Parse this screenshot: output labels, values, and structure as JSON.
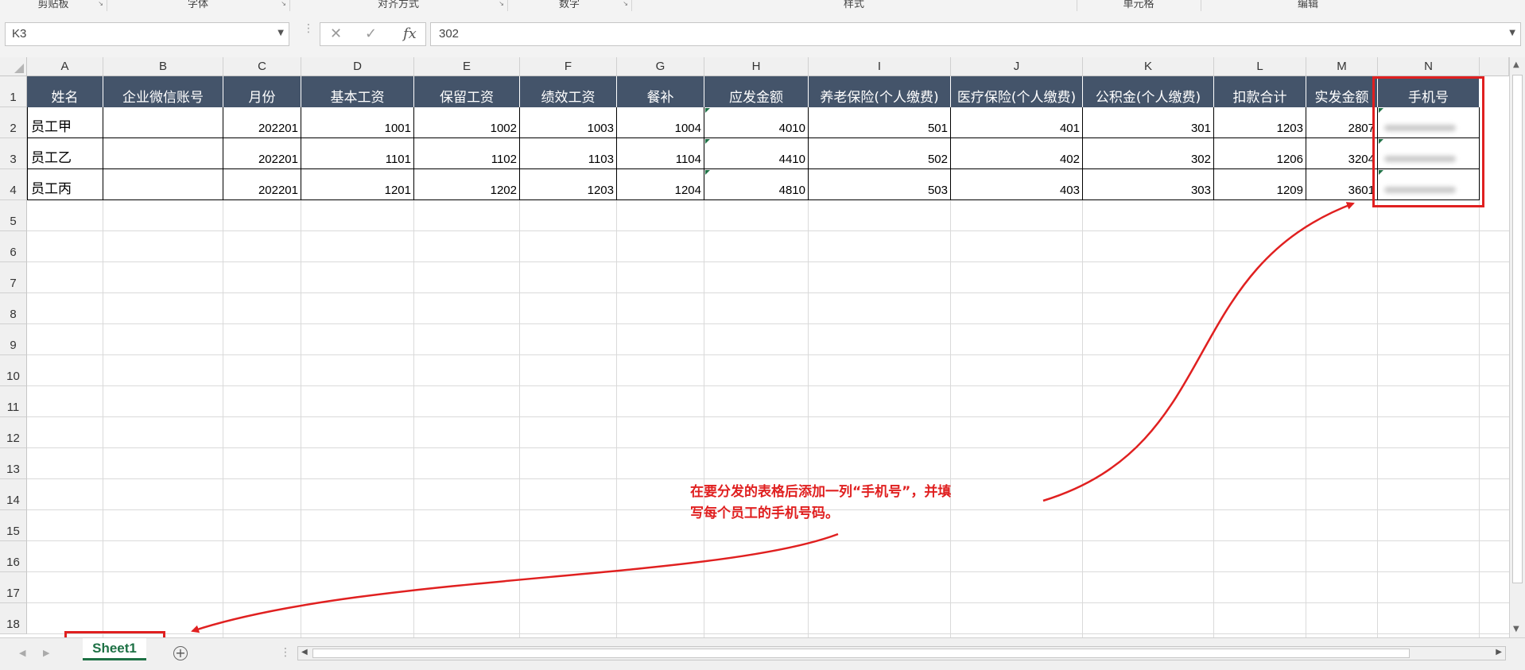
{
  "ribbon": {
    "groups": [
      {
        "label": "剪贴板"
      },
      {
        "label": "字体"
      },
      {
        "label": "对齐方式"
      },
      {
        "label": "数字"
      },
      {
        "label": "样式"
      },
      {
        "label": "单元格"
      },
      {
        "label": "编辑"
      }
    ]
  },
  "formula_bar": {
    "name_box": "K3",
    "cancel_icon": "✕",
    "enter_icon": "✓",
    "fx_label": "fx",
    "formula": "302"
  },
  "columns": [
    "A",
    "B",
    "C",
    "D",
    "E",
    "F",
    "G",
    "H",
    "I",
    "J",
    "K",
    "L",
    "M",
    "N"
  ],
  "rows": [
    "1",
    "2",
    "3",
    "4",
    "5",
    "6",
    "7",
    "8",
    "9",
    "10",
    "11",
    "12",
    "13",
    "14",
    "15",
    "16",
    "17",
    "18"
  ],
  "table": {
    "headers": [
      "姓名",
      "企业微信账号",
      "月份",
      "基本工资",
      "保留工资",
      "绩效工资",
      "餐补",
      "应发金额",
      "养老保险(个人缴费)",
      "医疗保险(个人缴费)",
      "公积金(个人缴费)",
      "扣款合计",
      "实发金额",
      "手机号"
    ],
    "data": [
      [
        "员工甲",
        "",
        "202201",
        "1001",
        "1002",
        "1003",
        "1004",
        "4010",
        "501",
        "401",
        "301",
        "1203",
        "2807",
        ""
      ],
      [
        "员工乙",
        "",
        "202201",
        "1101",
        "1102",
        "1103",
        "1104",
        "4410",
        "502",
        "402",
        "302",
        "1206",
        "3204",
        ""
      ],
      [
        "员工丙",
        "",
        "202201",
        "1201",
        "1202",
        "1203",
        "1204",
        "4810",
        "503",
        "403",
        "303",
        "1209",
        "3601",
        ""
      ]
    ]
  },
  "annotation": {
    "line1": "在要分发的表格后添加一列“手机号”，并填",
    "line2": "写每个员工的手机号码。",
    "color": "#e02020"
  },
  "sheets": {
    "active": "Sheet1",
    "add_icon": "+"
  },
  "colors": {
    "header_fill": "#44546a",
    "sheet_tab": "#1e7145"
  }
}
